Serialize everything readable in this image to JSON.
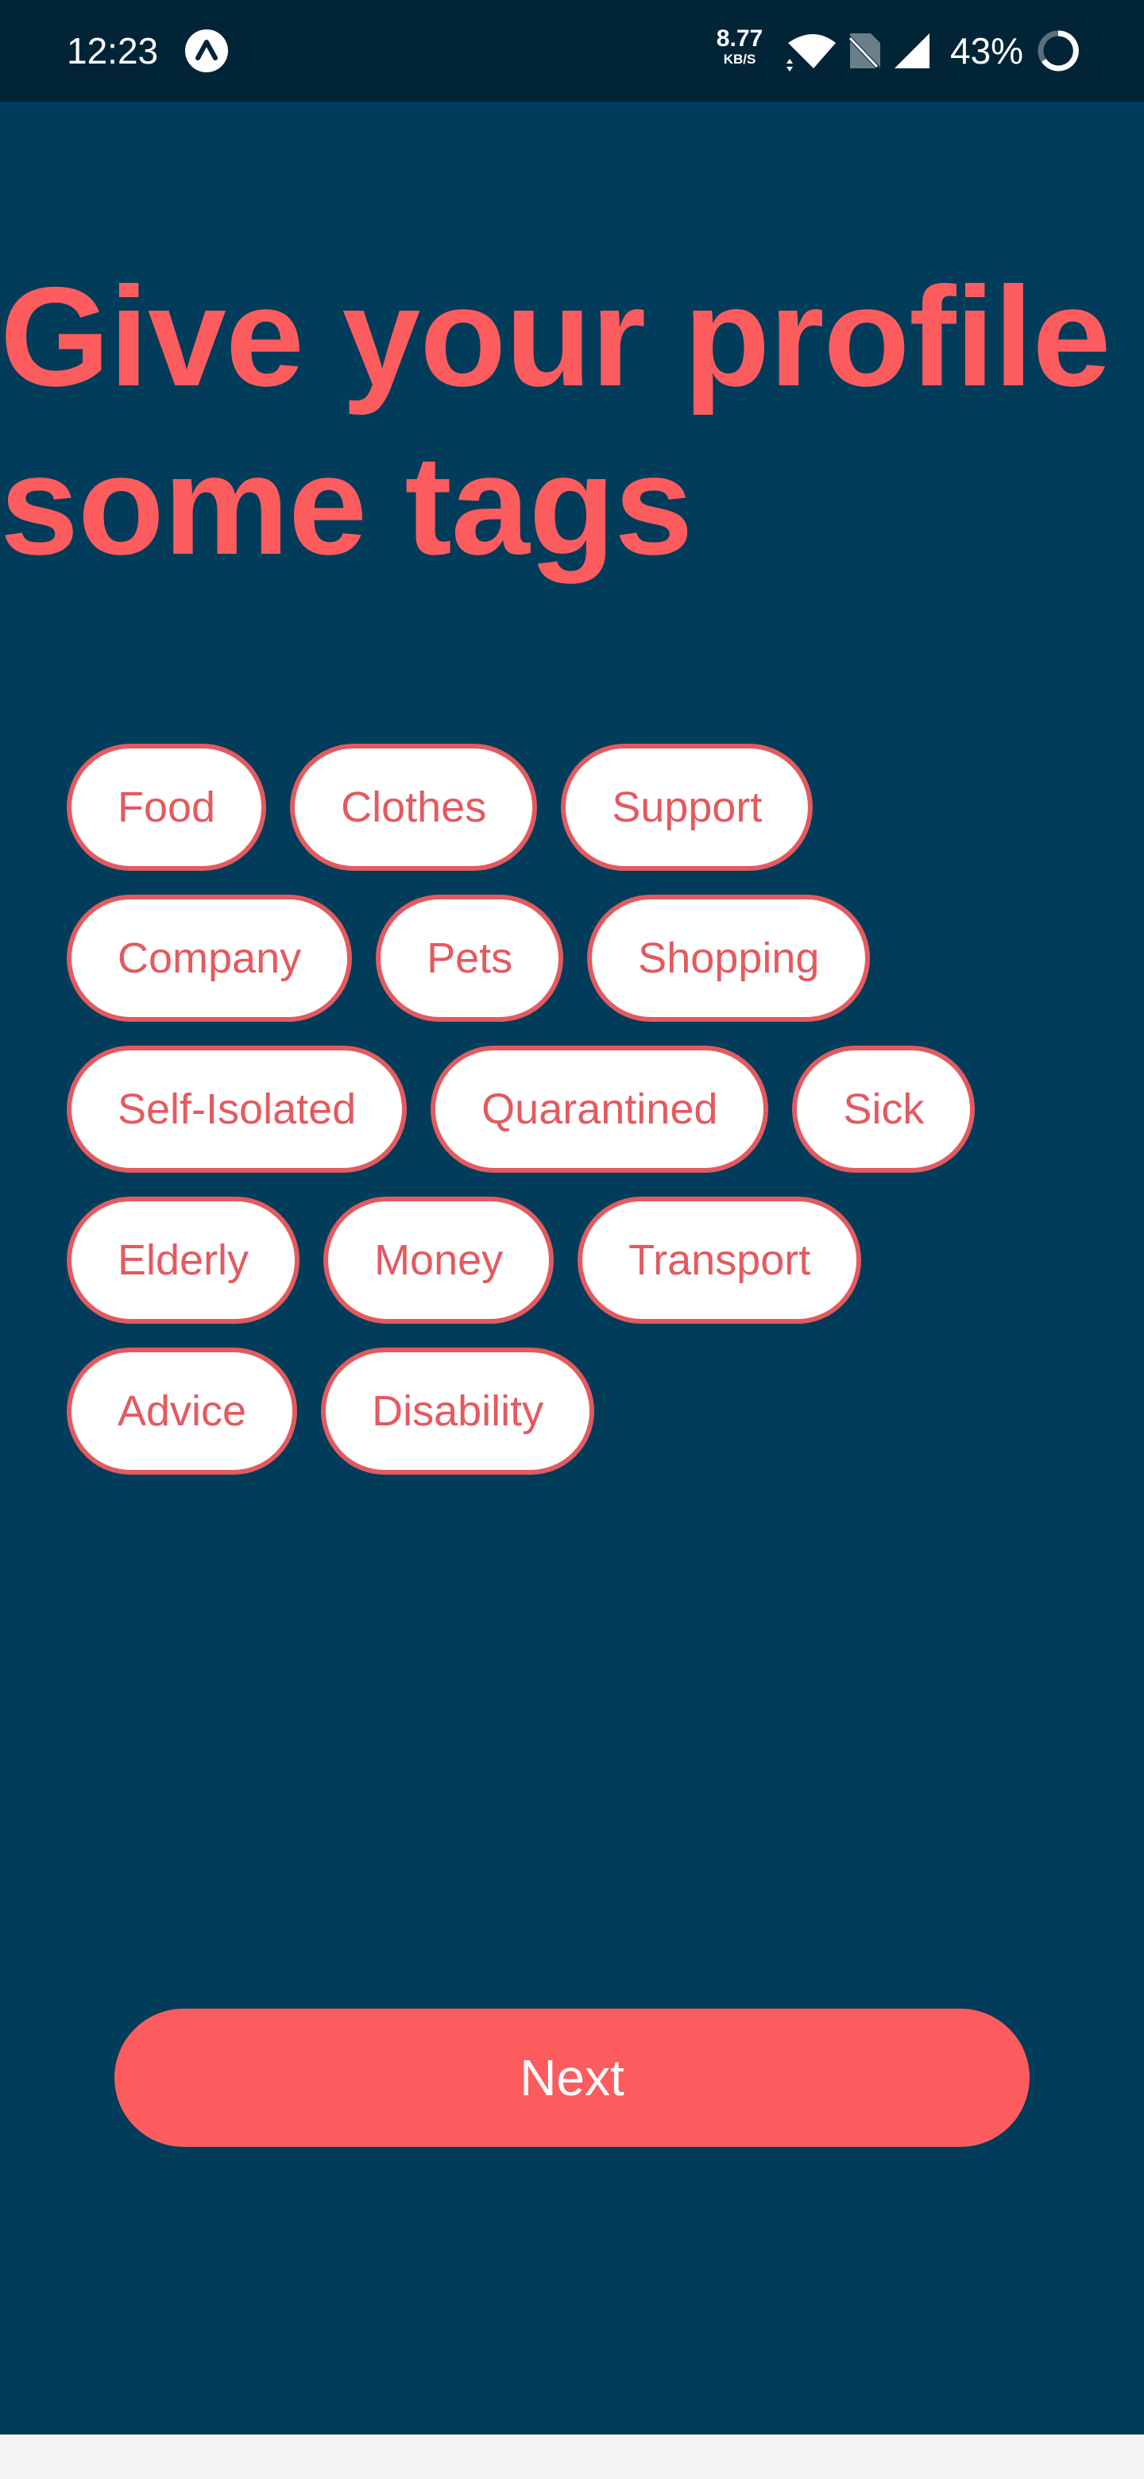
{
  "status_bar": {
    "time": "12:23",
    "net_speed": "8.77",
    "net_unit": "KB/S",
    "battery": "43%",
    "icons": [
      "app-notification-icon",
      "wifi-icon",
      "no-sim-icon",
      "cell-signal-icon",
      "battery-saver-icon"
    ]
  },
  "title": "Give your profile some tags",
  "tags": [
    "Food",
    "Clothes",
    "Support",
    "Company",
    "Pets",
    "Shopping",
    "Self-Isolated",
    "Quarantined",
    "Sick",
    "Elderly",
    "Money",
    "Transport",
    "Advice",
    "Disability"
  ],
  "next_label": "Next",
  "colors": {
    "background": "#013c5a",
    "status_bar": "#022437",
    "accent": "#fc5c5e",
    "tag_text": "#e35a5f",
    "tag_fill": "#ffffff",
    "nav_bar": "#f5f5f5"
  }
}
